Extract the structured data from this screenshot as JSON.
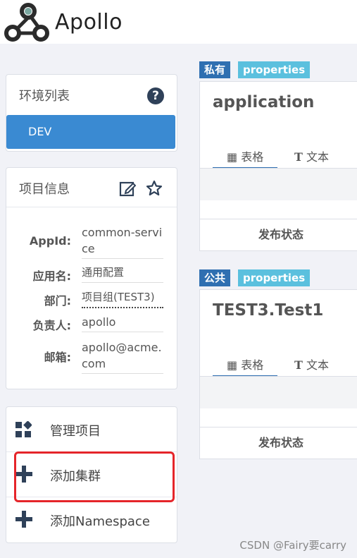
{
  "brand": {
    "name": "Apollo"
  },
  "env_panel": {
    "title": "环境列表",
    "help_glyph": "?",
    "env": "DEV"
  },
  "info_panel": {
    "title": "项目信息",
    "rows": [
      {
        "label": "AppId:",
        "value": "common-service"
      },
      {
        "label": "应用名:",
        "value": "通用配置"
      },
      {
        "label": "部门:",
        "value": "项目组(TEST3)"
      },
      {
        "label": "负责人:",
        "value": "apollo"
      },
      {
        "label": "邮箱:",
        "value": "apollo@acme.com"
      }
    ]
  },
  "nav": {
    "manage": "管理项目",
    "add_cluster": "添加集群",
    "add_namespace": "添加Namespace"
  },
  "namespaces": [
    {
      "scope": "私有",
      "format": "properties",
      "title": "application",
      "tab_table": "表格",
      "tab_text": "文本",
      "status": "发布状态"
    },
    {
      "scope": "公共",
      "format": "properties",
      "title": "TEST3.Test1",
      "tab_table": "表格",
      "tab_text": "文本",
      "status": "发布状态"
    }
  ],
  "watermark": "CSDN @Fairy要carry",
  "colors": {
    "accent": "#3a8ad2",
    "highlight_box": "#e5252a",
    "scope_tag": "#2f6fb1",
    "format_tag": "#5bc0de"
  }
}
